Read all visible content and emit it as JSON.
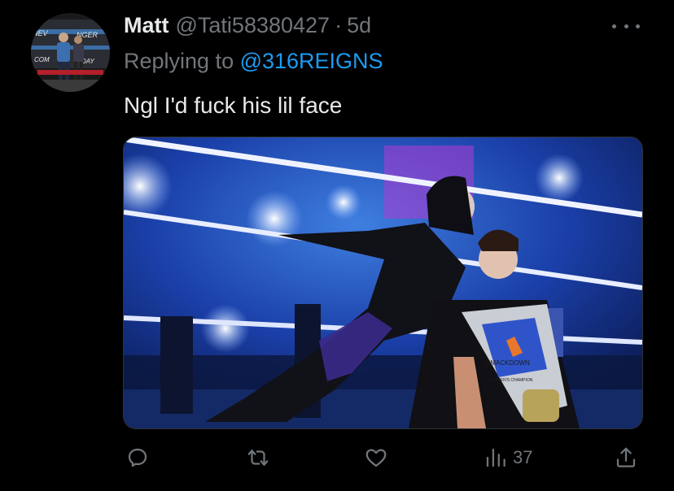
{
  "tweet": {
    "author_name": "Matt",
    "author_handle": "@Tati58380427",
    "separator": "·",
    "time": "5d",
    "reply_prefix": "Replying to ",
    "reply_mention": "@316REIGNS",
    "text": "Ngl I'd fuck his lil face"
  },
  "avatar_sign_text": [
    "NEV",
    "NGER",
    "COM",
    "DAY"
  ],
  "media_overlay_text": [
    "SMACKDOWN",
    "WOMEN'S CHAMPION"
  ],
  "actions": {
    "reply": {
      "icon": "reply-icon"
    },
    "retweet": {
      "icon": "retweet-icon"
    },
    "like": {
      "icon": "heart-icon"
    },
    "views": {
      "icon": "views-icon",
      "count": "37"
    },
    "share": {
      "icon": "share-icon"
    }
  },
  "colors": {
    "background": "#000000",
    "primary_text": "#e7e9ea",
    "secondary_text": "#71767b",
    "link": "#1d9bf0"
  }
}
